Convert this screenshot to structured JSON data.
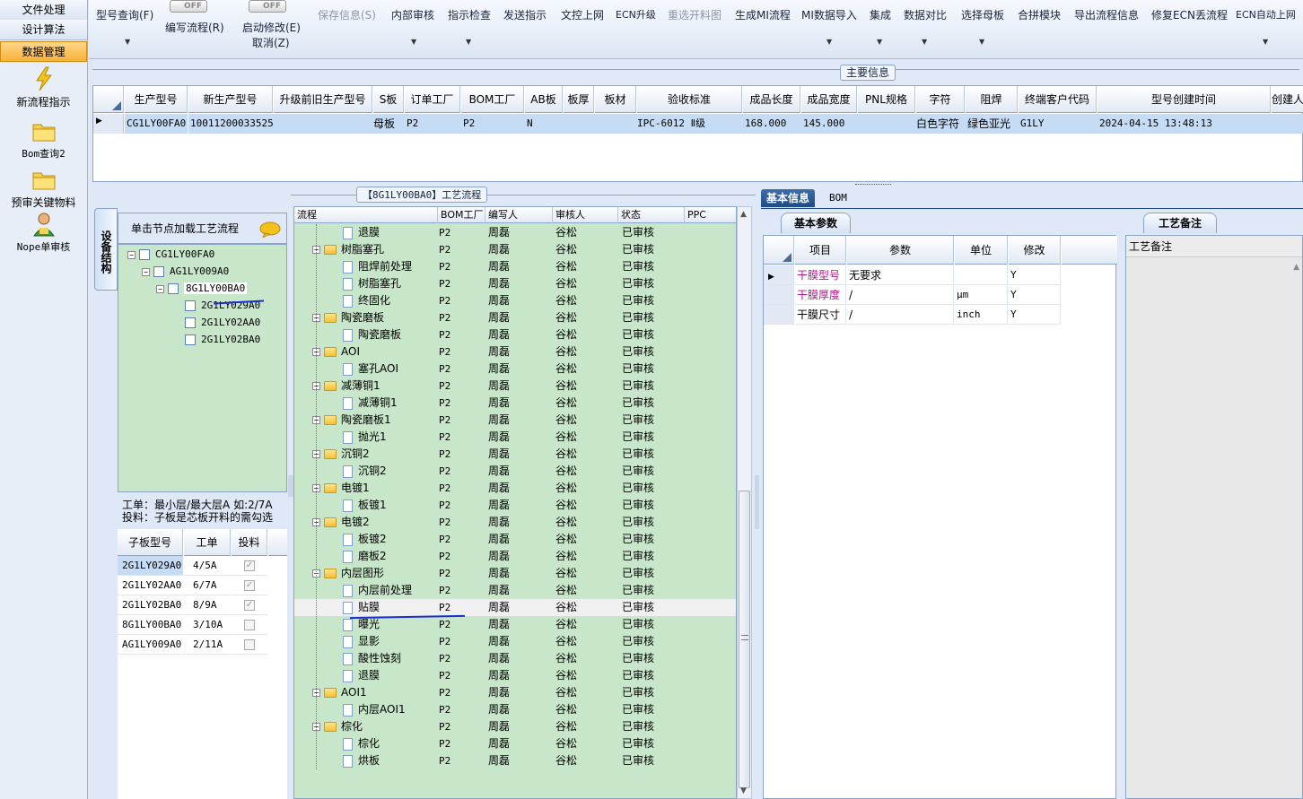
{
  "left_nav": {
    "tabs": [
      {
        "label": "文件处理",
        "active": false
      },
      {
        "label": "设计算法",
        "active": false
      },
      {
        "label": "数据管理",
        "active": true
      }
    ],
    "items": [
      {
        "label": "新流程指示",
        "icon": "lightning-icon"
      },
      {
        "label": "Bom查询2",
        "icon": "folder-icon"
      },
      {
        "label": "预审关键物料",
        "icon": "folder-icon"
      },
      {
        "label": "Nope单审核",
        "icon": "user-icon"
      }
    ]
  },
  "toolbar": {
    "buttons": [
      {
        "label": "型号查询(F)",
        "enabled": true,
        "has_dropdown": true
      },
      {
        "label": "编写流程(R)",
        "enabled": true,
        "toggle": "OFF"
      },
      {
        "label": "启动修改(E)",
        "sublabel": "取消(Z)",
        "enabled": true,
        "toggle": "OFF"
      },
      {
        "label": "保存信息(S)",
        "enabled": false
      },
      {
        "label": "内部审核",
        "enabled": true,
        "has_dropdown": true
      },
      {
        "label": "指示检查",
        "enabled": true,
        "has_dropdown": true
      },
      {
        "label": "发送指示",
        "enabled": true
      },
      {
        "label": "文控上网",
        "enabled": true
      },
      {
        "label": "ECN升级",
        "enabled": true
      },
      {
        "label": "重选开料图",
        "enabled": false
      },
      {
        "label": "生成MI流程",
        "enabled": true
      },
      {
        "label": "MI数据导入",
        "enabled": true,
        "has_dropdown": true
      },
      {
        "label": "集成",
        "enabled": true,
        "has_dropdown": true
      },
      {
        "label": "数据对比",
        "enabled": true,
        "has_dropdown": true
      },
      {
        "label": "选择母板",
        "enabled": true,
        "has_dropdown": true
      },
      {
        "label": "合拼模块",
        "enabled": true
      },
      {
        "label": "导出流程信息",
        "enabled": true
      },
      {
        "label": "修复ECN丢流程",
        "enabled": true
      },
      {
        "label": "ECN自动上网",
        "enabled": true,
        "has_dropdown": true
      }
    ]
  },
  "main_info": {
    "title": "主要信息",
    "columns": [
      "生产型号",
      "新生产型号",
      "升级前旧生产型号",
      "S板",
      "订单工厂",
      "BOM工厂",
      "AB板",
      "板厚",
      "板材",
      "验收标准",
      "成品长度",
      "成品宽度",
      "PNL规格",
      "字符",
      "阻焊",
      "终端客户代码",
      "型号创建时间",
      "创建人"
    ],
    "rows": [
      [
        "CG1LY00FA0",
        "10011200033525",
        "",
        "母板",
        "P2",
        "P2",
        "N",
        "",
        "",
        "IPC-6012 Ⅱ级",
        "168.000",
        "145.000",
        "",
        "白色字符",
        "绿色亚光",
        "G1LY",
        "2024-04-15 13:48:13",
        ""
      ]
    ]
  },
  "structure_panel": {
    "side_tab": "设备结构",
    "header": "单击节点加载工艺流程",
    "tree": [
      {
        "label": "CG1LY00FA0",
        "level": 0
      },
      {
        "label": "AG1LY009A0",
        "level": 1
      },
      {
        "label": "8G1LY00BA0",
        "level": 2,
        "selected": true
      },
      {
        "label": "2G1LY029A0",
        "level": 3
      },
      {
        "label": "2G1LY02AA0",
        "level": 3
      },
      {
        "label": "2G1LY02BA0",
        "level": 3
      }
    ],
    "note_line1": "工单：最小层/最大层A 如:2/7A",
    "note_line2": "投料：子板是芯板开料的需勾选",
    "sub_columns": [
      "子板型号",
      "工单",
      "投料"
    ],
    "sub_rows": [
      {
        "model": "2G1LY029A0",
        "order": "4/5A",
        "feed": true
      },
      {
        "model": "2G1LY02AA0",
        "order": "6/7A",
        "feed": true
      },
      {
        "model": "2G1LY02BA0",
        "order": "8/9A",
        "feed": true
      },
      {
        "model": "8G1LY00BA0",
        "order": "3/10A",
        "feed": false
      },
      {
        "model": "AG1LY009A0",
        "order": "2/11A",
        "feed": false
      }
    ]
  },
  "process_panel": {
    "title": "【8G1LY00BA0】工艺流程",
    "columns": [
      "流程",
      "BOM工厂",
      "编写人",
      "审核人",
      "状态",
      "PPC"
    ],
    "rows": [
      {
        "name": "退膜",
        "folder": false,
        "bom": "P2",
        "writer": "周磊",
        "reviewer": "谷松",
        "status": "已审核"
      },
      {
        "name": "树脂塞孔",
        "folder": true,
        "bom": "P2",
        "writer": "周磊",
        "reviewer": "谷松",
        "status": "已审核"
      },
      {
        "name": "阻焊前处理",
        "folder": false,
        "bom": "P2",
        "writer": "周磊",
        "reviewer": "谷松",
        "status": "已审核"
      },
      {
        "name": "树脂塞孔",
        "folder": false,
        "bom": "P2",
        "writer": "周磊",
        "reviewer": "谷松",
        "status": "已审核"
      },
      {
        "name": "终固化",
        "folder": false,
        "bom": "P2",
        "writer": "周磊",
        "reviewer": "谷松",
        "status": "已审核"
      },
      {
        "name": "陶瓷磨板",
        "folder": true,
        "bom": "P2",
        "writer": "周磊",
        "reviewer": "谷松",
        "status": "已审核"
      },
      {
        "name": "陶瓷磨板",
        "folder": false,
        "bom": "P2",
        "writer": "周磊",
        "reviewer": "谷松",
        "status": "已审核"
      },
      {
        "name": "AOI",
        "folder": true,
        "bom": "P2",
        "writer": "周磊",
        "reviewer": "谷松",
        "status": "已审核"
      },
      {
        "name": "塞孔AOI",
        "folder": false,
        "bom": "P2",
        "writer": "周磊",
        "reviewer": "谷松",
        "status": "已审核"
      },
      {
        "name": "减薄铜1",
        "folder": true,
        "bom": "P2",
        "writer": "周磊",
        "reviewer": "谷松",
        "status": "已审核"
      },
      {
        "name": "减薄铜1",
        "folder": false,
        "bom": "P2",
        "writer": "周磊",
        "reviewer": "谷松",
        "status": "已审核"
      },
      {
        "name": "陶瓷磨板1",
        "folder": true,
        "bom": "P2",
        "writer": "周磊",
        "reviewer": "谷松",
        "status": "已审核"
      },
      {
        "name": "抛光1",
        "folder": false,
        "bom": "P2",
        "writer": "周磊",
        "reviewer": "谷松",
        "status": "已审核"
      },
      {
        "name": "沉铜2",
        "folder": true,
        "bom": "P2",
        "writer": "周磊",
        "reviewer": "谷松",
        "status": "已审核"
      },
      {
        "name": "沉铜2",
        "folder": false,
        "bom": "P2",
        "writer": "周磊",
        "reviewer": "谷松",
        "status": "已审核"
      },
      {
        "name": "电镀1",
        "folder": true,
        "bom": "P2",
        "writer": "周磊",
        "reviewer": "谷松",
        "status": "已审核"
      },
      {
        "name": "板镀1",
        "folder": false,
        "bom": "P2",
        "writer": "周磊",
        "reviewer": "谷松",
        "status": "已审核"
      },
      {
        "name": "电镀2",
        "folder": true,
        "bom": "P2",
        "writer": "周磊",
        "reviewer": "谷松",
        "status": "已审核"
      },
      {
        "name": "板镀2",
        "folder": false,
        "bom": "P2",
        "writer": "周磊",
        "reviewer": "谷松",
        "status": "已审核"
      },
      {
        "name": "磨板2",
        "folder": false,
        "bom": "P2",
        "writer": "周磊",
        "reviewer": "谷松",
        "status": "已审核"
      },
      {
        "name": "内层图形",
        "folder": true,
        "bom": "P2",
        "writer": "周磊",
        "reviewer": "谷松",
        "status": "已审核"
      },
      {
        "name": "内层前处理",
        "folder": false,
        "bom": "P2",
        "writer": "周磊",
        "reviewer": "谷松",
        "status": "已审核"
      },
      {
        "name": "贴膜",
        "folder": false,
        "bom": "P2",
        "writer": "周磊",
        "reviewer": "谷松",
        "status": "已审核",
        "selected": true
      },
      {
        "name": "曝光",
        "folder": false,
        "bom": "P2",
        "writer": "周磊",
        "reviewer": "谷松",
        "status": "已审核"
      },
      {
        "name": "显影",
        "folder": false,
        "bom": "P2",
        "writer": "周磊",
        "reviewer": "谷松",
        "status": "已审核"
      },
      {
        "name": "酸性蚀刻",
        "folder": false,
        "bom": "P2",
        "writer": "周磊",
        "reviewer": "谷松",
        "status": "已审核"
      },
      {
        "name": "退膜",
        "folder": false,
        "bom": "P2",
        "writer": "周磊",
        "reviewer": "谷松",
        "status": "已审核"
      },
      {
        "name": "AOI1",
        "folder": true,
        "bom": "P2",
        "writer": "周磊",
        "reviewer": "谷松",
        "status": "已审核"
      },
      {
        "name": "内层AOI1",
        "folder": false,
        "bom": "P2",
        "writer": "周磊",
        "reviewer": "谷松",
        "status": "已审核"
      },
      {
        "name": "棕化",
        "folder": true,
        "bom": "P2",
        "writer": "周磊",
        "reviewer": "谷松",
        "status": "已审核"
      },
      {
        "name": "棕化",
        "folder": false,
        "bom": "P2",
        "writer": "周磊",
        "reviewer": "谷松",
        "status": "已审核"
      },
      {
        "name": "烘板",
        "folder": false,
        "bom": "P2",
        "writer": "周磊",
        "reviewer": "谷松",
        "status": "已审核"
      }
    ]
  },
  "right_panel": {
    "tabs": [
      {
        "label": "基本信息",
        "active": true
      },
      {
        "label": "BOM",
        "active": false
      }
    ],
    "params_tab": "基本参数",
    "param_columns": [
      "项目",
      "参数",
      "单位",
      "修改"
    ],
    "param_rows": [
      {
        "item": "干膜型号",
        "value": "无要求",
        "unit": "",
        "modify": "Y",
        "highlight": true
      },
      {
        "item": "干膜厚度",
        "value": "/",
        "unit": "μm",
        "modify": "Y",
        "highlight": true
      },
      {
        "item": "干膜尺寸",
        "value": "/",
        "unit": "inch",
        "modify": "Y",
        "highlight": false
      }
    ],
    "notes_tab": "工艺备注",
    "notes_header": "工艺备注"
  },
  "colors": {
    "accent_orange": "#f6b23a",
    "tree_green": "#c8e6c9",
    "selected_blue": "#c6dcf5",
    "highlight_magenta": "#b0188a",
    "annotation_blue": "#1a2fd0"
  }
}
